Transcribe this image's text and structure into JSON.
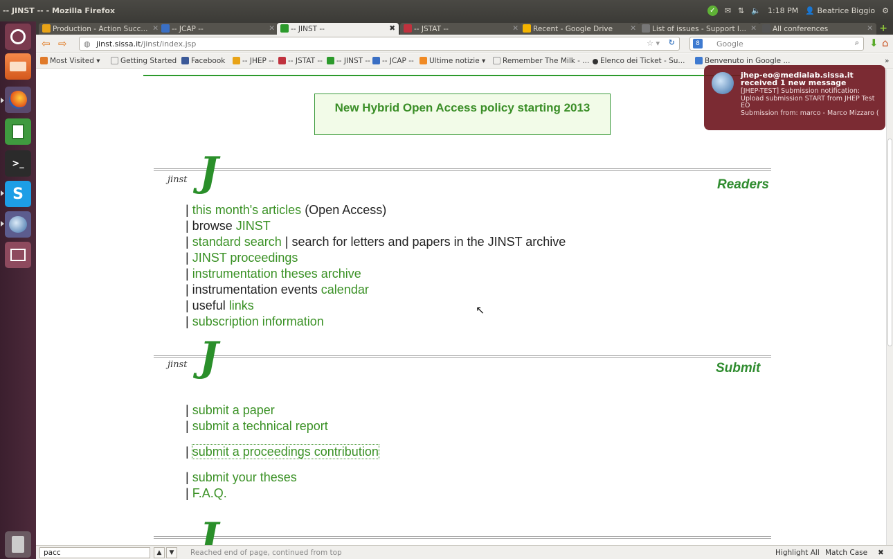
{
  "window": {
    "title": "-- JINST -- - Mozilla Firefox",
    "clock": "1:18 PM",
    "user": "Beatrice Biggio"
  },
  "tabs": [
    {
      "label": "Production - Action Succ...",
      "active": false,
      "icon_color": "#e8a317"
    },
    {
      "label": "-- JCAP --",
      "active": false,
      "icon_color": "#3a6fc4"
    },
    {
      "label": "-- JINST --",
      "active": true,
      "icon_color": "#2c9a2c"
    },
    {
      "label": "-- JSTAT --",
      "active": false,
      "icon_color": "#c0323e"
    },
    {
      "label": "Recent - Google Drive",
      "active": false,
      "icon_color": "#f4b400"
    },
    {
      "label": "List of issues - Support I...",
      "active": false,
      "icon_color": "#777777"
    },
    {
      "label": "All conferences",
      "active": false,
      "icon_color": "#555555"
    }
  ],
  "navbar": {
    "url_host": "jinst.sissa.it",
    "url_path": "/jinst/index.jsp",
    "search_placeholder": "Google",
    "search_engine_icon": "8"
  },
  "bookmarks": [
    "Most Visited ▾",
    "Getting Started",
    "Facebook",
    "-- JHEP --",
    "-- JSTAT --",
    "-- JINST --",
    "-- JCAP --",
    "Ultime notizie ▾",
    "Remember The Milk - ...",
    "Elenco dei Ticket - Su...",
    "Benvenuto in Google ..."
  ],
  "bookmarks_overflow": "»",
  "banner": {
    "text": "New Hybrid Open Access policy starting 2013"
  },
  "readers": {
    "logo_text": "jinst",
    "logo_letter": "J",
    "title": "Readers",
    "rows": [
      {
        "pre": "| ",
        "link": "this month's articles",
        "post": " (Open Access)"
      },
      {
        "pre": "| browse ",
        "link": "JINST",
        "post": ""
      },
      {
        "pre": "| ",
        "link": "standard search",
        "post": " | search for letters and papers in the JINST archive"
      },
      {
        "pre": "| ",
        "link": "JINST proceedings",
        "post": ""
      },
      {
        "pre": "| ",
        "link": "instrumentation theses archive",
        "post": ""
      },
      {
        "pre": "| instrumentation events ",
        "link": "calendar",
        "post": ""
      },
      {
        "pre": "| useful ",
        "link": "links",
        "post": ""
      },
      {
        "pre": "| ",
        "link": "subscription information",
        "post": ""
      }
    ]
  },
  "submit": {
    "logo_text": "jinst",
    "logo_letter": "J",
    "title": "Submit",
    "rows": [
      {
        "pre": "| ",
        "link": "submit a paper"
      },
      {
        "pre": "| ",
        "link": "submit a technical report"
      },
      {
        "pre": "| ",
        "link": "submit a proceedings contribution"
      },
      {
        "pre": "| ",
        "link": "submit your theses"
      },
      {
        "pre": "| ",
        "link": "F.A.Q."
      }
    ]
  },
  "notification": {
    "title": "jhep-eo@medialab.sissa.it received 1 new message",
    "body1": "[JHEP-TEST] Submission notification: Upload submission START from JHEP Test EO",
    "body2": "Submission from: marco - Marco Mizzaro ("
  },
  "findbar": {
    "query": "pacc",
    "status": "Reached end of page, continued from top",
    "highlight_all": "Highlight All",
    "match_case": "Match Case"
  }
}
